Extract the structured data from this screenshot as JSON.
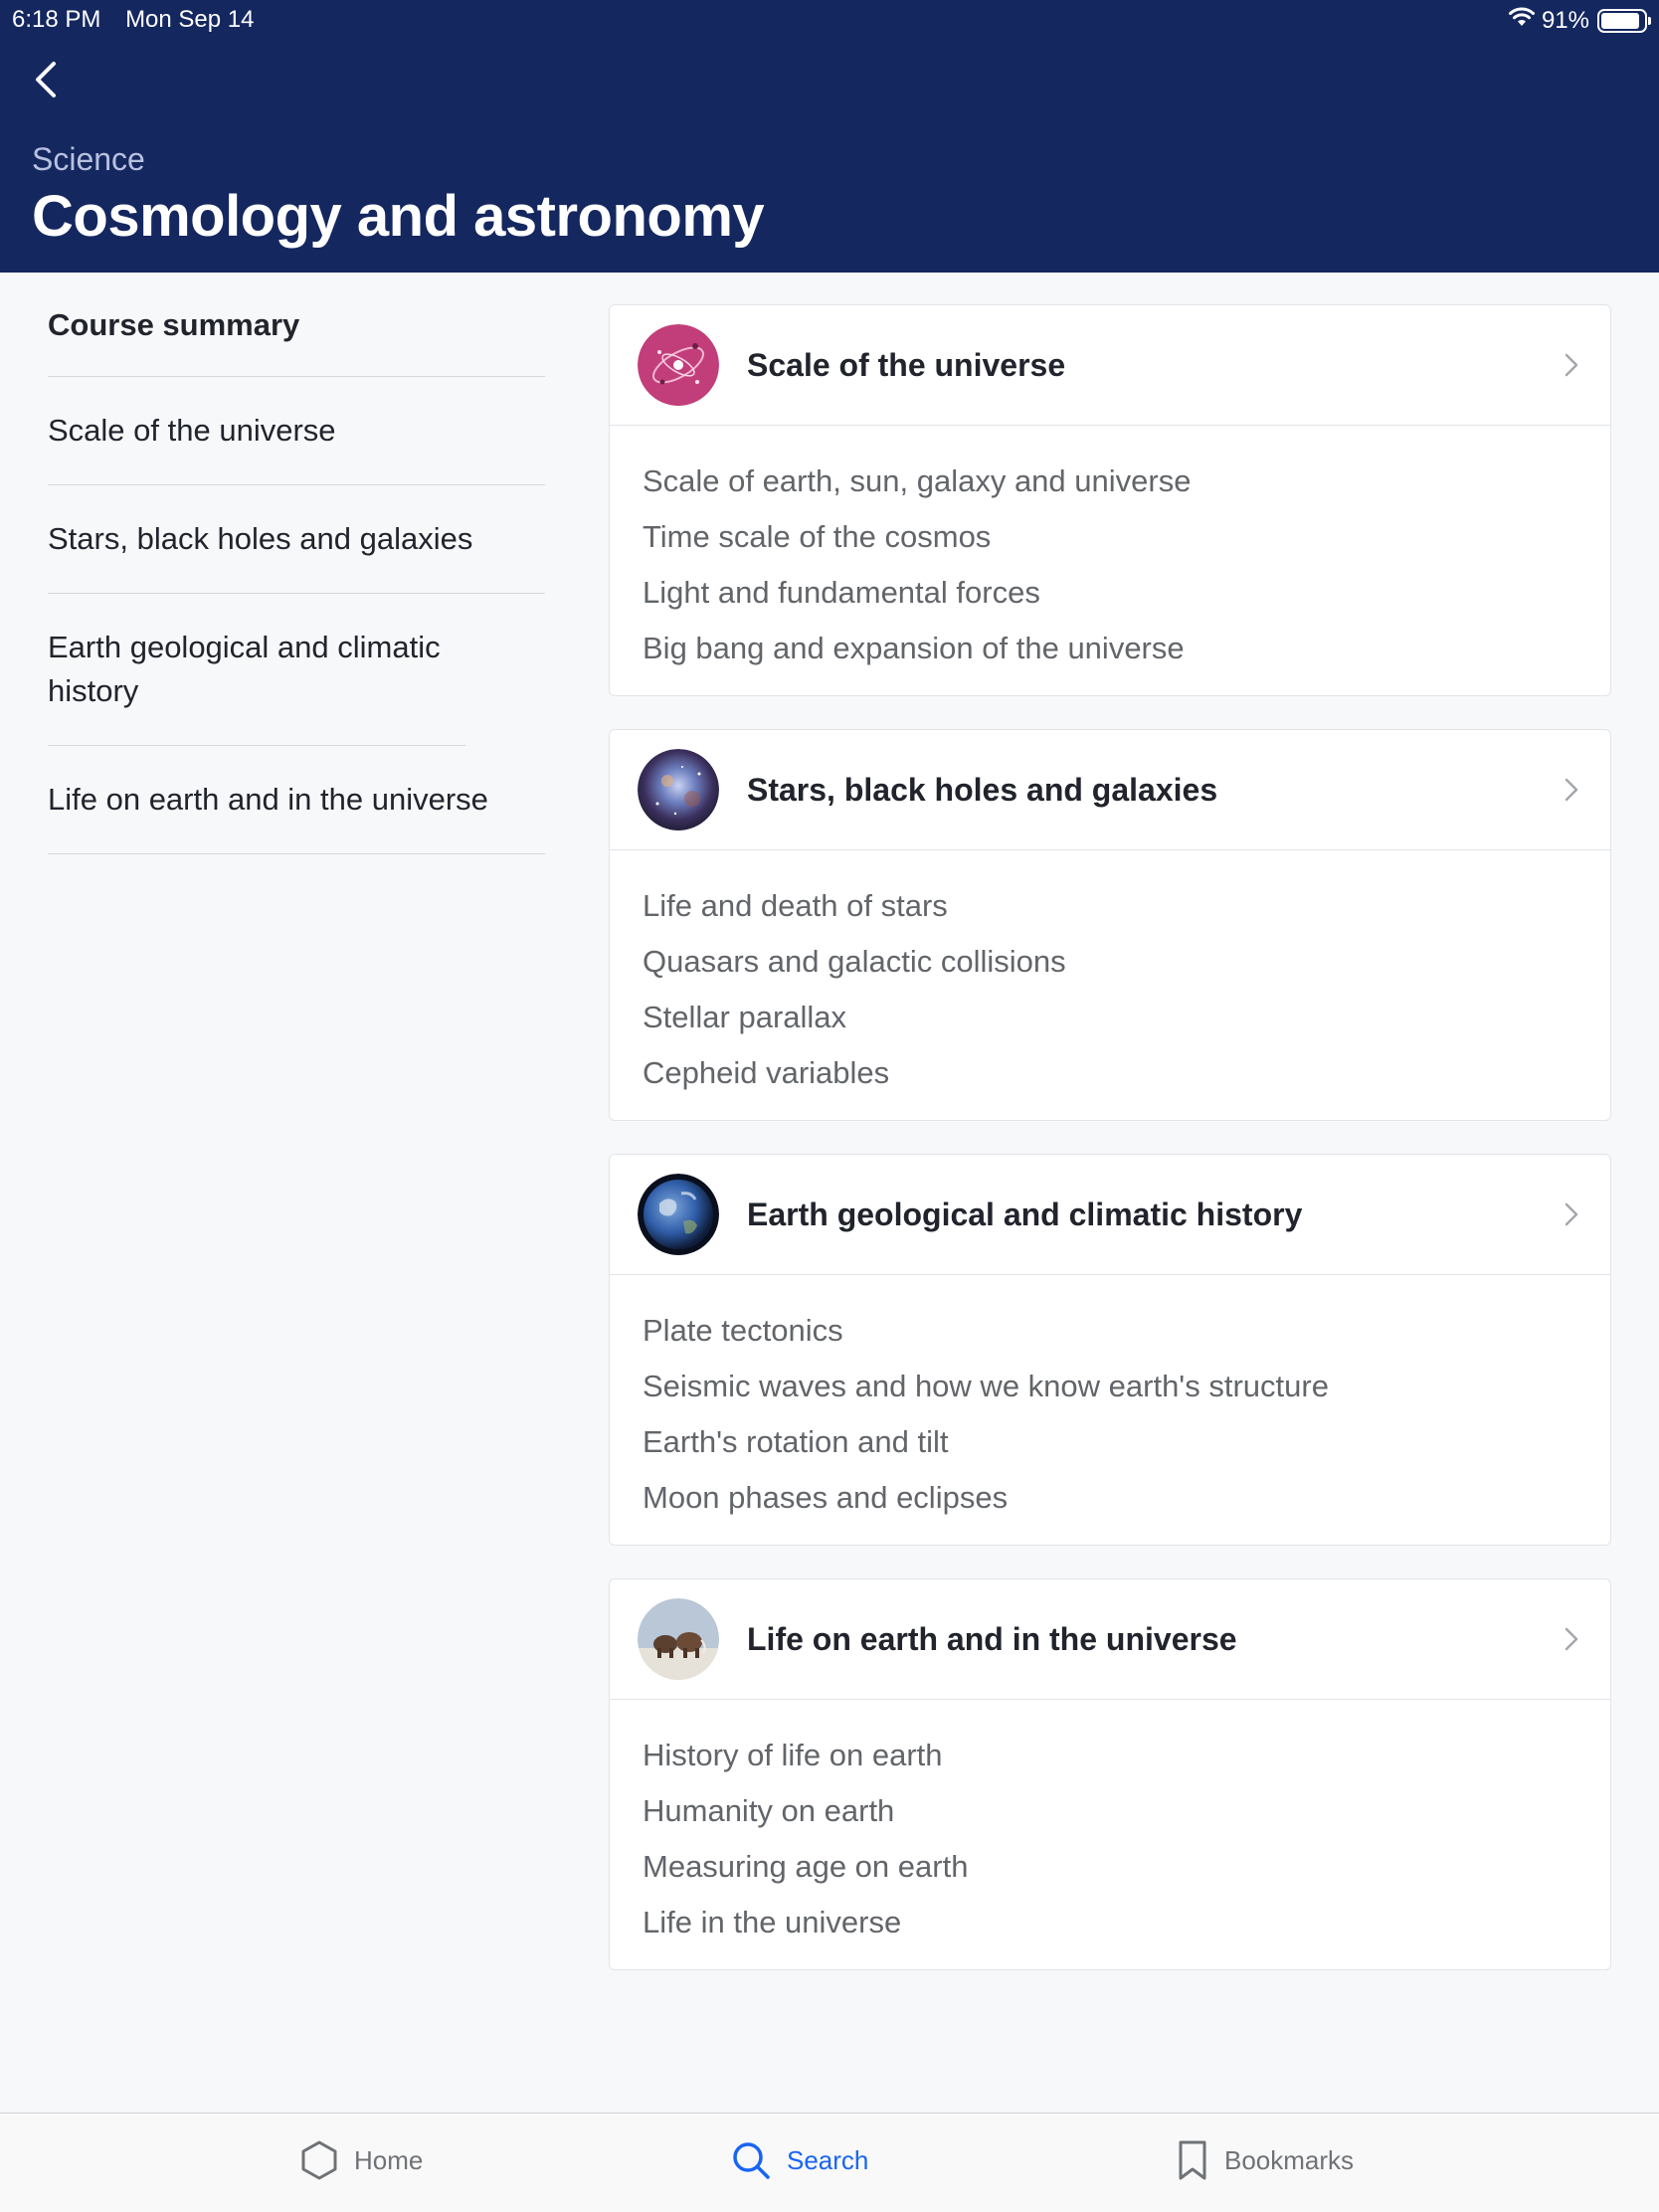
{
  "status_bar": {
    "time": "6:18 PM",
    "date": "Mon Sep 14",
    "battery": "91%",
    "battery_level": 0.91,
    "icons": [
      "wifi-icon",
      "battery-icon"
    ]
  },
  "header": {
    "back_icon": "chevron-left-icon",
    "subject": "Science",
    "title": "Cosmology and astronomy"
  },
  "sidebar": {
    "summary_label": "Course summary",
    "items": [
      {
        "label": "Scale of the universe"
      },
      {
        "label": "Stars, black holes and galaxies"
      },
      {
        "label": "Earth geological and climatic history"
      },
      {
        "label": "Life on earth and in the universe"
      }
    ]
  },
  "units": [
    {
      "title": "Scale of the universe",
      "icon": "galaxy-icon",
      "icon_color": "#c23e7a",
      "topics": [
        "Scale of earth, sun, galaxy and universe",
        "Time scale of the cosmos",
        "Light and fundamental forces",
        "Big bang and expansion of the universe"
      ]
    },
    {
      "title": "Stars, black holes and galaxies",
      "icon": "nebula-icon",
      "icon_color": "#3b4a80",
      "topics": [
        "Life and death of stars",
        "Quasars and galactic collisions",
        "Stellar parallax",
        "Cepheid variables"
      ]
    },
    {
      "title": "Earth geological and climatic history",
      "icon": "earth-icon",
      "icon_color": "#2f5da8",
      "topics": [
        "Plate tectonics",
        "Seismic waves and how we know earth's structure",
        "Earth's rotation and tilt",
        "Moon phases and eclipses"
      ]
    },
    {
      "title": "Life on earth and in the universe",
      "icon": "mammoth-icon",
      "icon_color": "#8a7d6b",
      "topics": [
        "History of life on earth",
        "Humanity on earth",
        "Measuring age on earth",
        "Life in the universe"
      ]
    }
  ],
  "tabbar": {
    "home": {
      "label": "Home",
      "icon": "hexagon-icon"
    },
    "search": {
      "label": "Search",
      "icon": "search-icon"
    },
    "bookmarks": {
      "label": "Bookmarks",
      "icon": "bookmark-icon"
    },
    "active_color": "#1865f2"
  }
}
